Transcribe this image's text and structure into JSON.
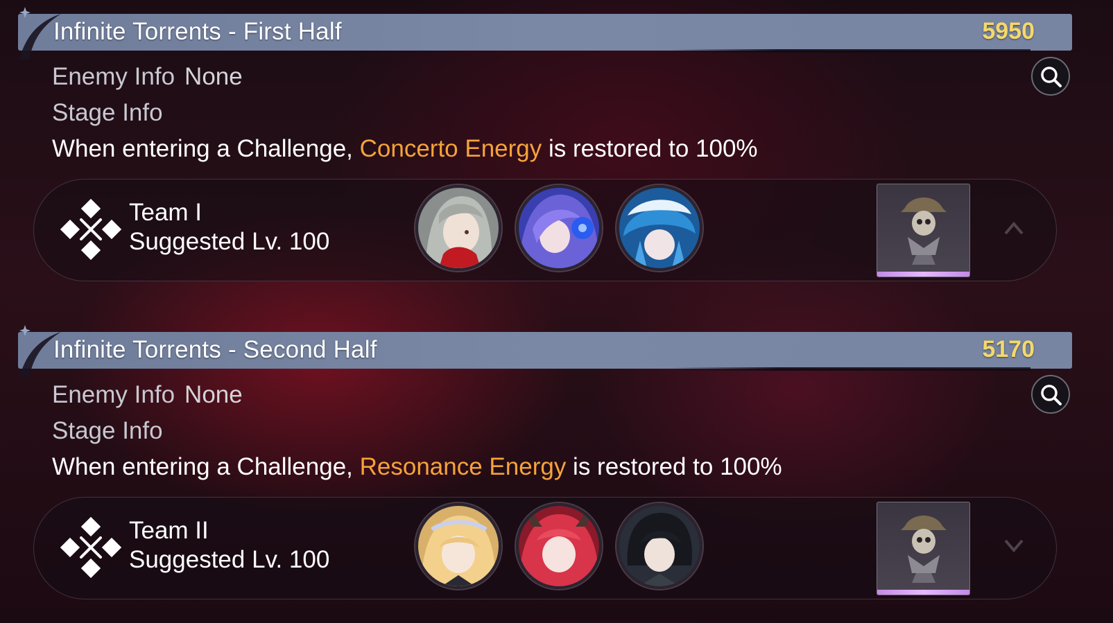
{
  "stages": [
    {
      "title": "Infinite Torrents - First Half",
      "score": "5950",
      "enemy_info_label": "Enemy Info",
      "enemy_info_value": "None",
      "stage_info_label": "Stage Info",
      "description": {
        "prefix": "When entering a Challenge, ",
        "highlight": "Concerto Energy",
        "suffix": " is restored to 100%"
      },
      "team": {
        "name": "Team I",
        "level": "Suggested Lv. 100",
        "avatars": [
          "character-avatar-grey-hair",
          "character-avatar-purple-hair",
          "character-avatar-blue-hat"
        ],
        "boss_icon": "pirate-skull-bust-icon"
      }
    },
    {
      "title": "Infinite Torrents - Second Half",
      "score": "5170",
      "enemy_info_label": "Enemy Info",
      "enemy_info_value": "None",
      "stage_info_label": "Stage Info",
      "description": {
        "prefix": "When entering a Challenge, ",
        "highlight": "Resonance Energy",
        "suffix": " is restored to 100%"
      },
      "team": {
        "name": "Team II",
        "level": "Suggested Lv. 100",
        "avatars": [
          "character-avatar-blonde-crown",
          "character-avatar-red-horns",
          "character-avatar-dark-hair"
        ],
        "boss_icon": "pirate-skull-bust-icon"
      }
    }
  ],
  "colors": {
    "title_bar": "#7382a0",
    "score": "#f5d86a",
    "highlight": "#f5a33a",
    "label": "#c8c8d0",
    "rarity": "#d6a4f5"
  }
}
